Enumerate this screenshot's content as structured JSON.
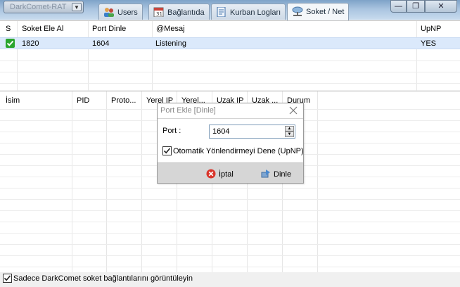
{
  "app": {
    "dropdown_label": "DarkComet-RAT"
  },
  "tabs": [
    {
      "label": "Users",
      "icon": "users-icon"
    },
    {
      "label": "Bağlantıda",
      "icon": "calendar-icon"
    },
    {
      "label": "Kurban Logları",
      "icon": "log-icon"
    },
    {
      "label": "Soket / Net",
      "icon": "network-icon",
      "active": true
    }
  ],
  "window": {
    "minimize": "—",
    "restore": "❐",
    "close": "✕"
  },
  "socket_table": {
    "columns": [
      "S",
      "Soket Ele Al",
      "Port Dinle",
      "@Mesaj",
      "UpNP"
    ],
    "rows": [
      {
        "status_icon": "check-icon",
        "socket": "1820",
        "port": "1604",
        "message": "Listening",
        "upnp": "YES"
      }
    ]
  },
  "connection_table": {
    "columns": [
      "İsim",
      "PID",
      "Proto...",
      "Yerel IP",
      "Yerel...",
      "Uzak IP",
      "Uzak ...",
      "Durum"
    ]
  },
  "dialog": {
    "title": "Port Ekle [Dinle]",
    "port_label": "Port :",
    "port_value": "1604",
    "upnp_checkbox_label": "Otomatik Yönlendirmeyi Dene (UpNP)",
    "upnp_checked": true,
    "cancel_label": "İptal",
    "listen_label": "Dinle"
  },
  "footer": {
    "checkbox_label": "Sadece DarkComet soket bağlantılarını görüntüleyin",
    "checked": true
  },
  "colors": {
    "selection": "#dbe9fb",
    "ok_green": "#2aa52e",
    "cancel_red": "#d9352b"
  }
}
